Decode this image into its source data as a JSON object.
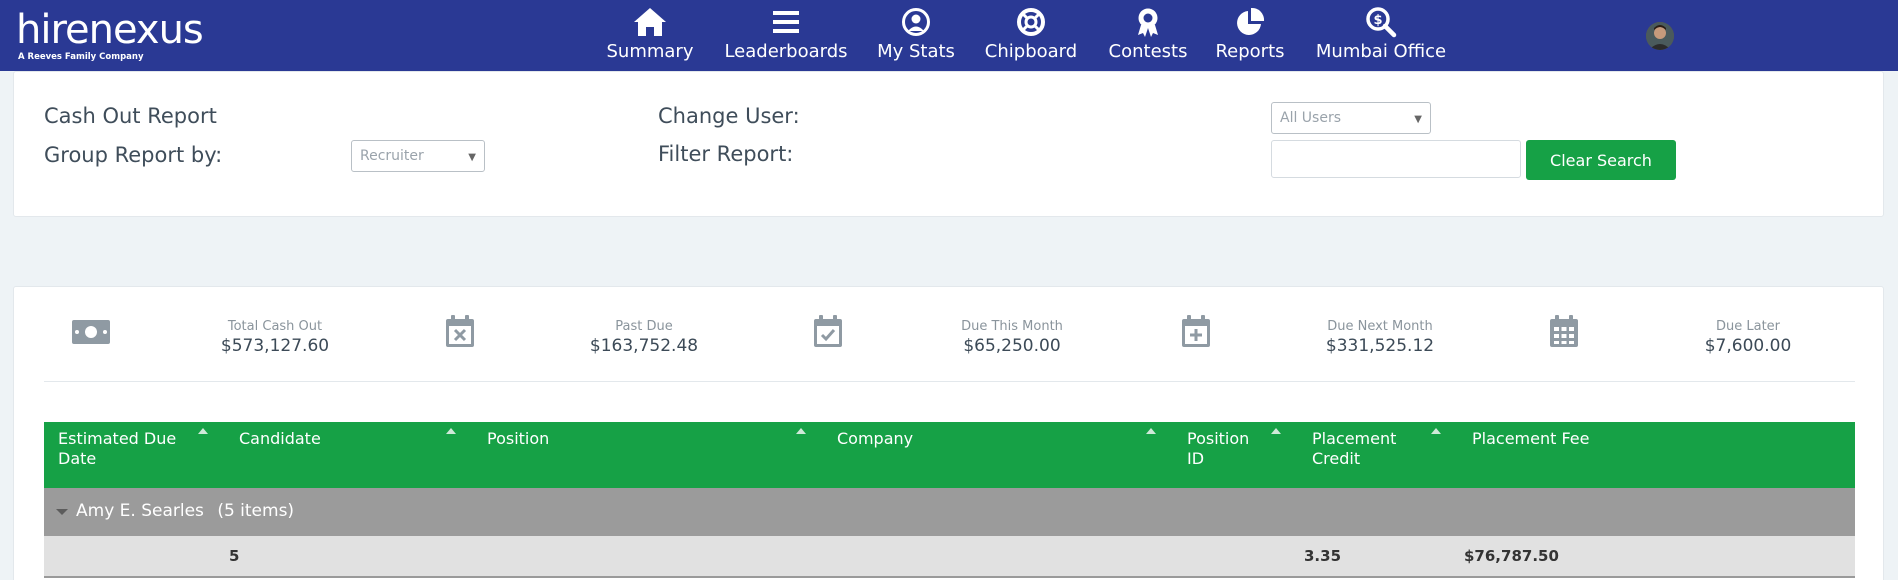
{
  "brand": {
    "name": "hirenexus",
    "tagline": "A Reeves Family Company"
  },
  "nav": [
    {
      "label": "Summary",
      "icon": "home-icon"
    },
    {
      "label": "Leaderboards",
      "icon": "bars-icon"
    },
    {
      "label": "My Stats",
      "icon": "user-circle-icon"
    },
    {
      "label": "Chipboard",
      "icon": "lifebuoy-icon"
    },
    {
      "label": "Contests",
      "icon": "award-icon"
    },
    {
      "label": "Reports",
      "icon": "pie-chart-icon"
    },
    {
      "label": "Mumbai Office",
      "icon": "search-dollar-icon"
    }
  ],
  "filters": {
    "report_title": "Cash Out Report",
    "group_by_label": "Group Report by:",
    "group_by_value": "Recruiter",
    "change_user_label": "Change User:",
    "user_value": "All Users",
    "filter_label": "Filter Report:",
    "filter_value": "",
    "clear_button": "Clear Search"
  },
  "stats": [
    {
      "label": "Total Cash Out",
      "value": "$573,127.60",
      "icon": "money-icon"
    },
    {
      "label": "Past Due",
      "value": "$163,752.48",
      "icon": "calendar-x-icon"
    },
    {
      "label": "Due This Month",
      "value": "$65,250.00",
      "icon": "calendar-check-icon"
    },
    {
      "label": "Due Next Month",
      "value": "$331,525.12",
      "icon": "calendar-plus-icon"
    },
    {
      "label": "Due Later",
      "value": "$7,600.00",
      "icon": "calendar-icon"
    }
  ],
  "table": {
    "columns": [
      {
        "line1": "Estimated Due",
        "line2": "Date"
      },
      {
        "line1": "Candidate",
        "line2": ""
      },
      {
        "line1": "Position",
        "line2": ""
      },
      {
        "line1": "Company",
        "line2": ""
      },
      {
        "line1": "Position",
        "line2": "ID"
      },
      {
        "line1": "Placement",
        "line2": "Credit"
      },
      {
        "line1": "Placement Fee",
        "line2": ""
      }
    ],
    "group": {
      "name": "Amy E. Searles",
      "count": "(5 items)"
    },
    "totals": {
      "candidate_count": "5",
      "placement_credit": "3.35",
      "placement_fee": "$76,787.50"
    }
  },
  "colors": {
    "nav_bg": "#2a3994",
    "accent_green": "#16a146",
    "group_row": "#9b9b9b",
    "icon_gray": "#8f9aa3"
  }
}
